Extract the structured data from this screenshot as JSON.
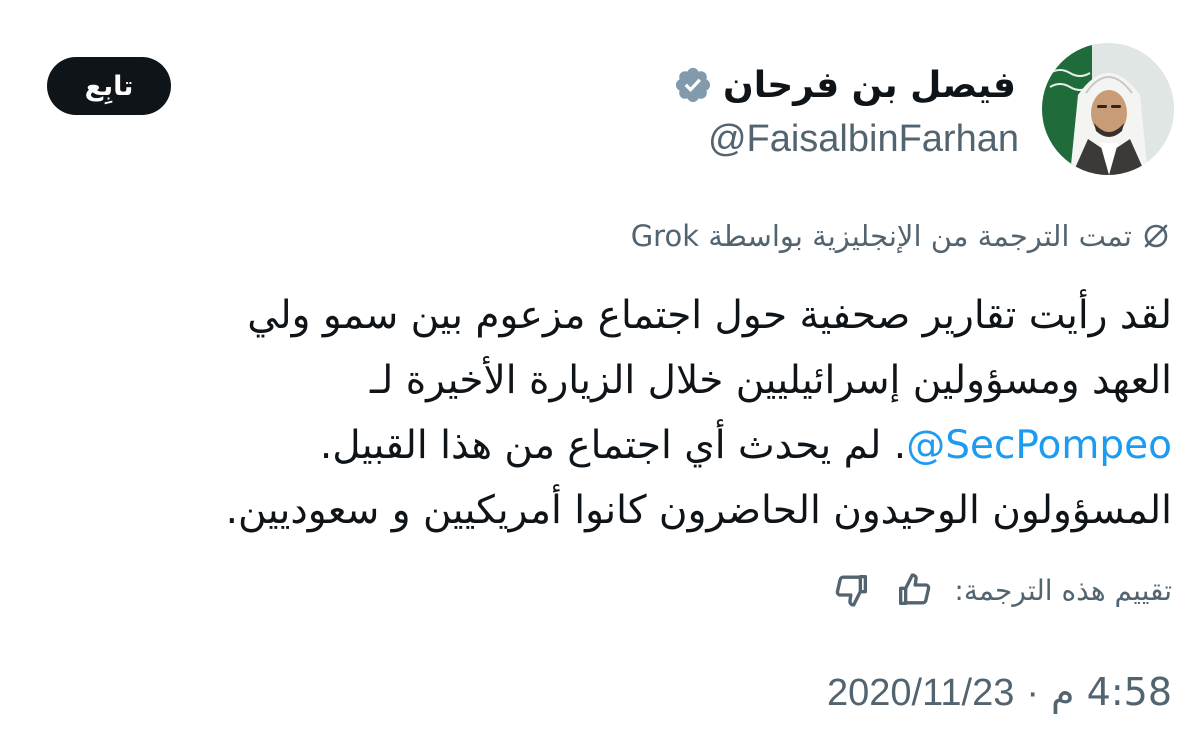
{
  "user": {
    "display_name": "فيصل بن فرحان",
    "handle": "@FaisalbinFarhan",
    "avatar_icon": "profile-photo",
    "verified_icon": "verified-badge-icon",
    "verified_color": "#829aab"
  },
  "follow_button": {
    "label": "تابِع"
  },
  "translation": {
    "notice": "تمت الترجمة من الإنجليزية بواسطة Grok",
    "icon": "translate-icon"
  },
  "body": {
    "line1": "لقد رأيت تقارير صحفية حول اجتماع مزعوم بين سمو ولي",
    "line2": "العهد ومسؤولين إسرائيليين خلال الزيارة الأخيرة لـ",
    "mention": "@SecPompeo",
    "line3_rest": ". لم يحدث أي اجتماع من هذا القبيل.",
    "line4": "المسؤولون الوحيدون الحاضرون كانوا أمريكيين و سعوديين."
  },
  "rating": {
    "label": "تقييم هذه الترجمة:",
    "thumbs_up_icon": "thumbs-up-icon",
    "thumbs_down_icon": "thumbs-down-icon"
  },
  "timestamp": {
    "time": "4:58 م",
    "separator": "·",
    "date": "2020/11/23"
  },
  "colors": {
    "text_primary": "#0f1419",
    "text_secondary": "#536471",
    "link": "#1d9bf0",
    "button_bg": "#0f1419"
  }
}
